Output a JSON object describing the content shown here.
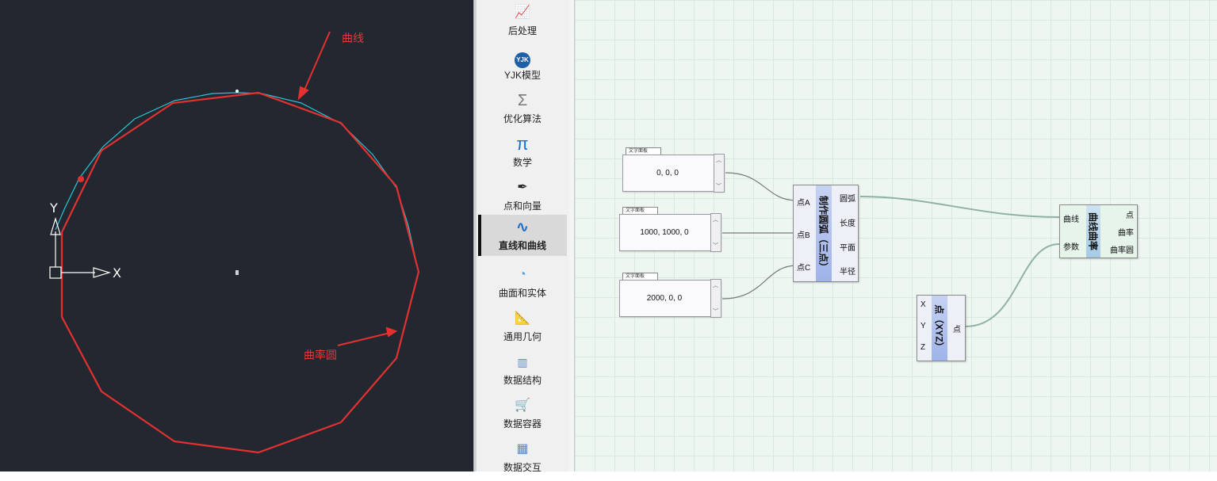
{
  "cad": {
    "annotations": {
      "curve": "曲线",
      "curvature_circle": "曲率圆"
    },
    "axis": {
      "x": "X",
      "y": "Y"
    },
    "colors": {
      "background": "#222730",
      "curve": "#29c5d6",
      "circle": "#e53030",
      "axis": "#ffffff"
    }
  },
  "palette": {
    "items": [
      {
        "label": "后处理",
        "icon": "chart-icon"
      },
      {
        "label": "YJK模型",
        "icon": "yjk-logo-icon"
      },
      {
        "label": "优化算法",
        "icon": "sigma-icon"
      },
      {
        "label": "数学",
        "icon": "pi-icon"
      },
      {
        "label": "点和向量",
        "icon": "point-vector-icon"
      },
      {
        "label": "直线和曲线",
        "icon": "curve-icon",
        "active": true
      },
      {
        "label": "曲面和实体",
        "icon": "surface-icon"
      },
      {
        "label": "通用几何",
        "icon": "ruler-icon"
      },
      {
        "label": "数据结构",
        "icon": "data-structure-icon"
      },
      {
        "label": "数据容器",
        "icon": "cart-icon"
      },
      {
        "label": "数据交互",
        "icon": "building-icon"
      }
    ]
  },
  "canvas": {
    "panels": [
      {
        "tab": "文字面板",
        "value": "0, 0, 0"
      },
      {
        "tab": "文字面板",
        "value": "1000, 1000, 0"
      },
      {
        "tab": "文字面板",
        "value": "2000, 0, 0"
      }
    ],
    "arc_component": {
      "title": "制作圆弧（三点）",
      "inputs": [
        "点A",
        "点B",
        "点C"
      ],
      "outputs": [
        "圆弧",
        "长度",
        "平面",
        "半径"
      ]
    },
    "curvature_component": {
      "title": "曲线曲率",
      "inputs": [
        "曲线",
        "参数"
      ],
      "outputs": [
        "点",
        "曲率",
        "曲率圆"
      ]
    },
    "point_component": {
      "title": "点（XYZ）",
      "inputs": [
        "X",
        "Y",
        "Z"
      ],
      "outputs": [
        "点"
      ]
    }
  }
}
